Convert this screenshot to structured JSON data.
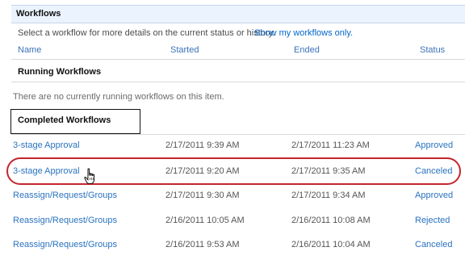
{
  "section": {
    "title": "Workflows",
    "instruction": "Select a workflow for more details on the current status or history.",
    "show_mine_link": "Show my workflows only."
  },
  "columns": {
    "name": "Name",
    "started": "Started",
    "ended": "Ended",
    "status": "Status"
  },
  "running": {
    "title": "Running Workflows",
    "empty_message": "There are no currently running workflows on this item."
  },
  "completed": {
    "title": "Completed Workflows",
    "rows": [
      {
        "name": "3-stage Approval",
        "started": "2/17/2011 9:39 AM",
        "ended": "2/17/2011 11:23 AM",
        "status": "Approved"
      },
      {
        "name": "3-stage Approval",
        "started": "2/17/2011 9:20 AM",
        "ended": "2/17/2011 9:35 AM",
        "status": "Canceled"
      },
      {
        "name": "Reassign/Request/Groups",
        "started": "2/17/2011 9:30 AM",
        "ended": "2/17/2011 9:34 AM",
        "status": "Approved"
      },
      {
        "name": "Reassign/Request/Groups",
        "started": "2/16/2011 10:05 AM",
        "ended": "2/16/2011 10:08 AM",
        "status": "Rejected"
      },
      {
        "name": "Reassign/Request/Groups",
        "started": "2/16/2011 9:53 AM",
        "ended": "2/16/2011 10:04 AM",
        "status": "Canceled"
      }
    ]
  },
  "colors": {
    "link": "#2a73c0",
    "header_bg": "#ebf3ff",
    "highlight": "#c4262e"
  },
  "icons": {
    "pointer": "hand-pointer-icon"
  }
}
